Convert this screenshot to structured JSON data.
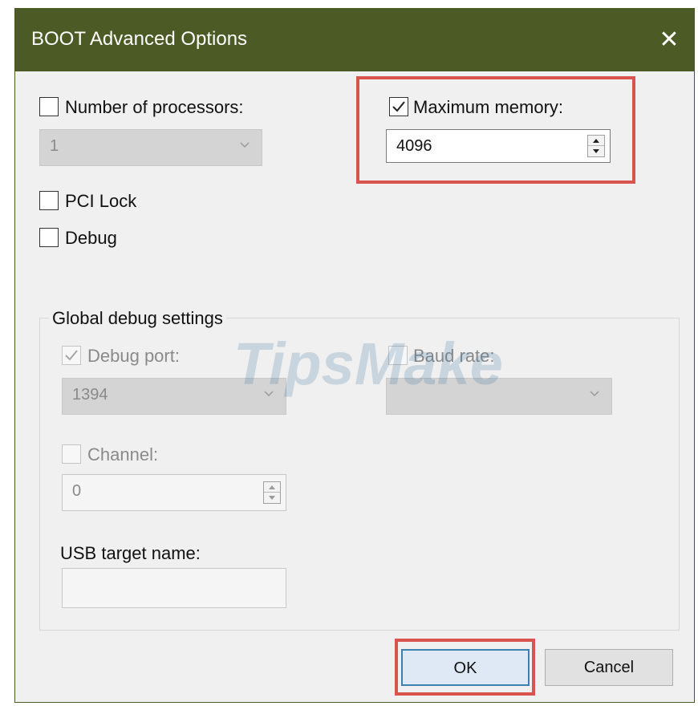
{
  "window": {
    "title": "BOOT Advanced Options",
    "close_symbol": "✕"
  },
  "processors": {
    "label": "Number of processors:",
    "checked": false,
    "value": "1",
    "enabled": false
  },
  "max_memory": {
    "label": "Maximum memory:",
    "checked": true,
    "value": "4096"
  },
  "pci_lock": {
    "label": "PCI Lock",
    "checked": false
  },
  "debug": {
    "label": "Debug",
    "checked": false
  },
  "global_debug": {
    "group_label": "Global debug settings",
    "debug_port": {
      "label": "Debug port:",
      "checked": true,
      "value": "1394",
      "enabled": false
    },
    "baud_rate": {
      "label": "Baud rate:",
      "checked": false,
      "value": "",
      "enabled": false
    },
    "channel": {
      "label": "Channel:",
      "checked": false,
      "value": "0",
      "enabled": false
    },
    "usb_target": {
      "label": "USB target name:",
      "value": "",
      "enabled": false
    }
  },
  "buttons": {
    "ok_label": "OK",
    "cancel_label": "Cancel"
  },
  "watermark": {
    "text": "TipsMake"
  },
  "colors": {
    "titlebar": "#4c5b25",
    "highlight": "#d9534f",
    "ok_border": "#3c7fb1",
    "dialog_bg": "#f0f0f0"
  }
}
